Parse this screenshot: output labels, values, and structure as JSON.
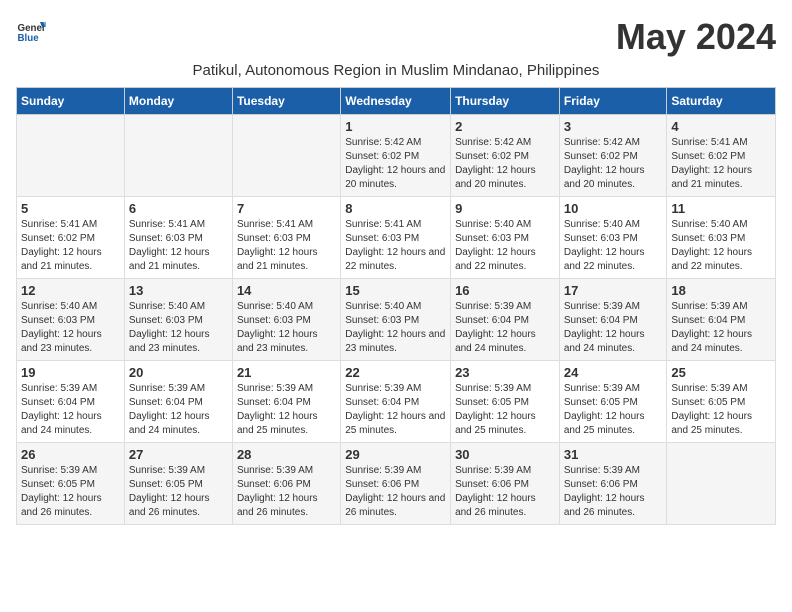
{
  "header": {
    "logo_line1": "General",
    "logo_line2": "Blue",
    "month_year": "May 2024",
    "subtitle": "Patikul, Autonomous Region in Muslim Mindanao, Philippines"
  },
  "days_of_week": [
    "Sunday",
    "Monday",
    "Tuesday",
    "Wednesday",
    "Thursday",
    "Friday",
    "Saturday"
  ],
  "weeks": [
    [
      {
        "num": "",
        "info": ""
      },
      {
        "num": "",
        "info": ""
      },
      {
        "num": "",
        "info": ""
      },
      {
        "num": "1",
        "info": "Sunrise: 5:42 AM\nSunset: 6:02 PM\nDaylight: 12 hours and 20 minutes."
      },
      {
        "num": "2",
        "info": "Sunrise: 5:42 AM\nSunset: 6:02 PM\nDaylight: 12 hours and 20 minutes."
      },
      {
        "num": "3",
        "info": "Sunrise: 5:42 AM\nSunset: 6:02 PM\nDaylight: 12 hours and 20 minutes."
      },
      {
        "num": "4",
        "info": "Sunrise: 5:41 AM\nSunset: 6:02 PM\nDaylight: 12 hours and 21 minutes."
      }
    ],
    [
      {
        "num": "5",
        "info": "Sunrise: 5:41 AM\nSunset: 6:02 PM\nDaylight: 12 hours and 21 minutes."
      },
      {
        "num": "6",
        "info": "Sunrise: 5:41 AM\nSunset: 6:03 PM\nDaylight: 12 hours and 21 minutes."
      },
      {
        "num": "7",
        "info": "Sunrise: 5:41 AM\nSunset: 6:03 PM\nDaylight: 12 hours and 21 minutes."
      },
      {
        "num": "8",
        "info": "Sunrise: 5:41 AM\nSunset: 6:03 PM\nDaylight: 12 hours and 22 minutes."
      },
      {
        "num": "9",
        "info": "Sunrise: 5:40 AM\nSunset: 6:03 PM\nDaylight: 12 hours and 22 minutes."
      },
      {
        "num": "10",
        "info": "Sunrise: 5:40 AM\nSunset: 6:03 PM\nDaylight: 12 hours and 22 minutes."
      },
      {
        "num": "11",
        "info": "Sunrise: 5:40 AM\nSunset: 6:03 PM\nDaylight: 12 hours and 22 minutes."
      }
    ],
    [
      {
        "num": "12",
        "info": "Sunrise: 5:40 AM\nSunset: 6:03 PM\nDaylight: 12 hours and 23 minutes."
      },
      {
        "num": "13",
        "info": "Sunrise: 5:40 AM\nSunset: 6:03 PM\nDaylight: 12 hours and 23 minutes."
      },
      {
        "num": "14",
        "info": "Sunrise: 5:40 AM\nSunset: 6:03 PM\nDaylight: 12 hours and 23 minutes."
      },
      {
        "num": "15",
        "info": "Sunrise: 5:40 AM\nSunset: 6:03 PM\nDaylight: 12 hours and 23 minutes."
      },
      {
        "num": "16",
        "info": "Sunrise: 5:39 AM\nSunset: 6:04 PM\nDaylight: 12 hours and 24 minutes."
      },
      {
        "num": "17",
        "info": "Sunrise: 5:39 AM\nSunset: 6:04 PM\nDaylight: 12 hours and 24 minutes."
      },
      {
        "num": "18",
        "info": "Sunrise: 5:39 AM\nSunset: 6:04 PM\nDaylight: 12 hours and 24 minutes."
      }
    ],
    [
      {
        "num": "19",
        "info": "Sunrise: 5:39 AM\nSunset: 6:04 PM\nDaylight: 12 hours and 24 minutes."
      },
      {
        "num": "20",
        "info": "Sunrise: 5:39 AM\nSunset: 6:04 PM\nDaylight: 12 hours and 24 minutes."
      },
      {
        "num": "21",
        "info": "Sunrise: 5:39 AM\nSunset: 6:04 PM\nDaylight: 12 hours and 25 minutes."
      },
      {
        "num": "22",
        "info": "Sunrise: 5:39 AM\nSunset: 6:04 PM\nDaylight: 12 hours and 25 minutes."
      },
      {
        "num": "23",
        "info": "Sunrise: 5:39 AM\nSunset: 6:05 PM\nDaylight: 12 hours and 25 minutes."
      },
      {
        "num": "24",
        "info": "Sunrise: 5:39 AM\nSunset: 6:05 PM\nDaylight: 12 hours and 25 minutes."
      },
      {
        "num": "25",
        "info": "Sunrise: 5:39 AM\nSunset: 6:05 PM\nDaylight: 12 hours and 25 minutes."
      }
    ],
    [
      {
        "num": "26",
        "info": "Sunrise: 5:39 AM\nSunset: 6:05 PM\nDaylight: 12 hours and 26 minutes."
      },
      {
        "num": "27",
        "info": "Sunrise: 5:39 AM\nSunset: 6:05 PM\nDaylight: 12 hours and 26 minutes."
      },
      {
        "num": "28",
        "info": "Sunrise: 5:39 AM\nSunset: 6:06 PM\nDaylight: 12 hours and 26 minutes."
      },
      {
        "num": "29",
        "info": "Sunrise: 5:39 AM\nSunset: 6:06 PM\nDaylight: 12 hours and 26 minutes."
      },
      {
        "num": "30",
        "info": "Sunrise: 5:39 AM\nSunset: 6:06 PM\nDaylight: 12 hours and 26 minutes."
      },
      {
        "num": "31",
        "info": "Sunrise: 5:39 AM\nSunset: 6:06 PM\nDaylight: 12 hours and 26 minutes."
      },
      {
        "num": "",
        "info": ""
      }
    ]
  ]
}
